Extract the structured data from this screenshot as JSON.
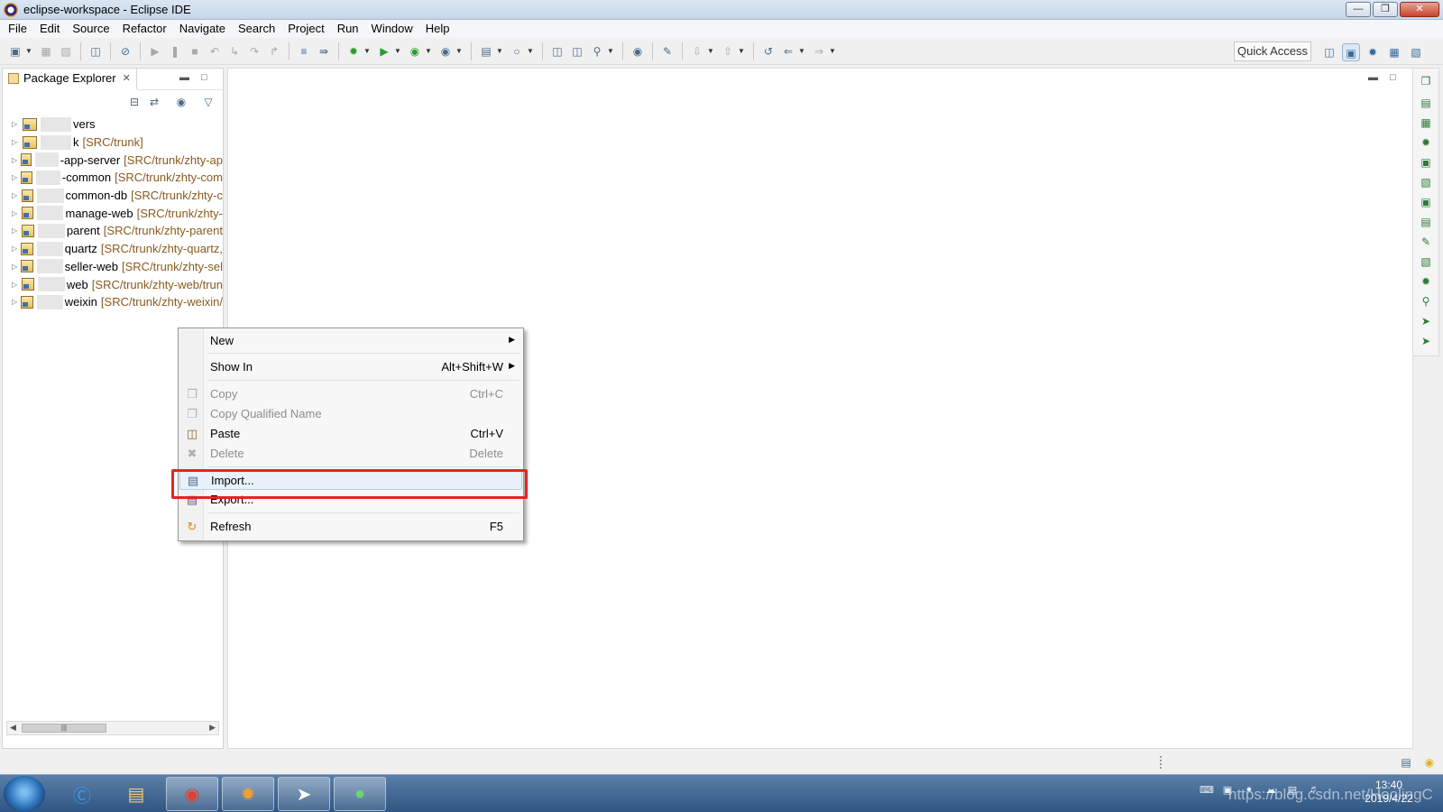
{
  "window": {
    "title": "eclipse-workspace - Eclipse IDE",
    "controls": [
      "minimize-icon",
      "restore-icon",
      "close-icon"
    ]
  },
  "menubar": {
    "items": [
      "File",
      "Edit",
      "Source",
      "Refactor",
      "Navigate",
      "Search",
      "Project",
      "Run",
      "Window",
      "Help"
    ]
  },
  "toolbar": {
    "quick_access": "Quick Access"
  },
  "package_explorer": {
    "tab_label": "Package Explorer",
    "projects": [
      {
        "name": "vers",
        "suffix": ""
      },
      {
        "name": "k",
        "suffix": "[SRC/trunk]"
      },
      {
        "name": "-app-server",
        "suffix": "[SRC/trunk/zhty-ap"
      },
      {
        "name": "-common",
        "suffix": "[SRC/trunk/zhty-com"
      },
      {
        "name": "common-db",
        "suffix": "[SRC/trunk/zhty-c"
      },
      {
        "name": "manage-web",
        "suffix": "[SRC/trunk/zhty-"
      },
      {
        "name": "parent",
        "suffix": "[SRC/trunk/zhty-parent"
      },
      {
        "name": "quartz",
        "suffix": "[SRC/trunk/zhty-quartz,"
      },
      {
        "name": "seller-web",
        "suffix": "[SRC/trunk/zhty-sel"
      },
      {
        "name": "web",
        "suffix": "[SRC/trunk/zhty-web/trun"
      },
      {
        "name": "weixin",
        "suffix": "[SRC/trunk/zhty-weixin/"
      }
    ]
  },
  "context_menu": {
    "items": [
      {
        "label": "New",
        "accel": "",
        "submenu": true,
        "enabled": true,
        "icon": ""
      },
      {
        "label": "Show In",
        "accel": "Alt+Shift+W",
        "submenu": true,
        "enabled": true,
        "icon": ""
      },
      {
        "label": "Copy",
        "accel": "Ctrl+C",
        "submenu": false,
        "enabled": false,
        "icon": "copy-icon"
      },
      {
        "label": "Copy Qualified Name",
        "accel": "",
        "submenu": false,
        "enabled": false,
        "icon": "copy-qualified-name-icon"
      },
      {
        "label": "Paste",
        "accel": "Ctrl+V",
        "submenu": false,
        "enabled": true,
        "icon": "paste-icon"
      },
      {
        "label": "Delete",
        "accel": "Delete",
        "submenu": false,
        "enabled": false,
        "icon": "delete-icon"
      },
      {
        "label": "Import...",
        "accel": "",
        "submenu": false,
        "enabled": true,
        "icon": "import-icon"
      },
      {
        "label": "Export...",
        "accel": "",
        "submenu": false,
        "enabled": true,
        "icon": "export-icon"
      },
      {
        "label": "Refresh",
        "accel": "F5",
        "submenu": false,
        "enabled": true,
        "icon": "refresh-icon"
      }
    ]
  },
  "taskbar": {
    "clock_time": "13:40",
    "clock_date": "2019/4/22",
    "watermark": "https://blog.csdn.net/HoolingC"
  },
  "colors": {
    "highlight_box": "#e8231f",
    "project_suffix": "#8a5a1e",
    "taskbar": "#2f5582"
  }
}
